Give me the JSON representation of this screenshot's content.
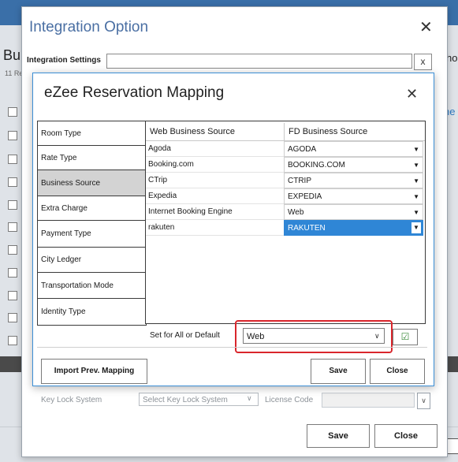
{
  "background_app": {
    "title_partial": "Bu",
    "count_partial": "11 Re",
    "right_text_partial": "ho",
    "right_link_partial": "ne"
  },
  "integration_option": {
    "title": "Integration Option",
    "settings_label": "Integration Settings",
    "settings_value": "",
    "clear_label": "x",
    "key_lock_label": "Key Lock System",
    "key_lock_placeholder": "Select Key Lock System",
    "license_label": "License Code",
    "license_value": "",
    "save_label": "Save",
    "close_label": "Close"
  },
  "mapping_dialog": {
    "title": "eZee Reservation Mapping",
    "categories": [
      {
        "label": "Room Type",
        "active": false
      },
      {
        "label": "Rate Type",
        "active": false
      },
      {
        "label": "Business Source",
        "active": true
      },
      {
        "label": "Extra Charge",
        "active": false
      },
      {
        "label": "Payment Type",
        "active": false
      },
      {
        "label": "City Ledger",
        "active": false
      },
      {
        "label": "Transportation Mode",
        "active": false
      },
      {
        "label": "Identity Type",
        "active": false
      }
    ],
    "columns": [
      "Web Business Source",
      "FD Business Source"
    ],
    "rows": [
      {
        "web": "Agoda",
        "fd": "AGODA",
        "selected": false
      },
      {
        "web": "Booking.com",
        "fd": "BOOKING.COM",
        "selected": false
      },
      {
        "web": "CTrip",
        "fd": "CTRIP",
        "selected": false
      },
      {
        "web": "Expedia",
        "fd": "EXPEDIA",
        "selected": false
      },
      {
        "web": "Internet Booking Engine",
        "fd": "Web",
        "selected": false
      },
      {
        "web": "rakuten",
        "fd": "RAKUTEN",
        "selected": true
      }
    ],
    "default_label": "Set for All or Default",
    "default_value": "Web",
    "import_label": "Import Prev. Mapping",
    "save_label": "Save",
    "close_label": "Close"
  },
  "colors": {
    "accent": "#2f86d6",
    "title_blue": "#4a6fa3",
    "highlight_red": "#d9262c",
    "active_category": "#d3d3d3"
  },
  "icons": {
    "close": "close-icon",
    "dropdown": "chevron-down-icon",
    "apply_all": "checklist-icon"
  }
}
